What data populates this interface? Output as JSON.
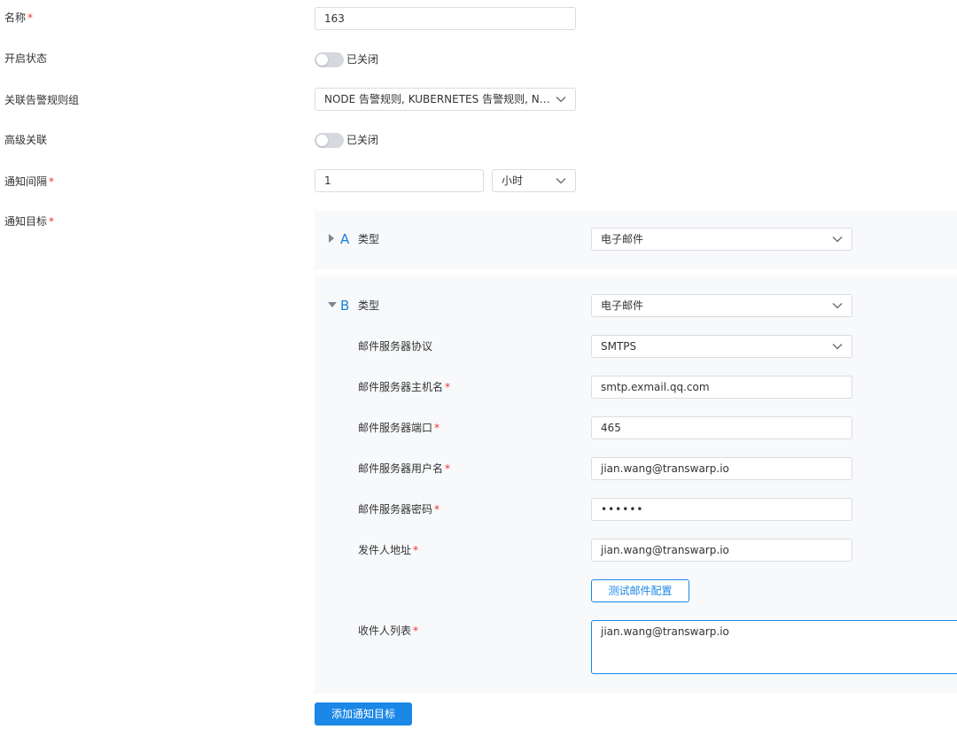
{
  "form": {
    "name": {
      "label": "名称",
      "value": "163"
    },
    "enabled": {
      "label": "开启状态",
      "state_text": "已关闭"
    },
    "rule_groups": {
      "label": "关联告警规则组",
      "value": "NODE 告警规则, KUBERNETES 告警规则, NETWORK 告警规则"
    },
    "advanced": {
      "label": "高级关联",
      "state_text": "已关闭"
    },
    "interval": {
      "label": "通知间隔",
      "value": "1",
      "unit": "小时"
    },
    "targets_label": "通知目标"
  },
  "targets": [
    {
      "letter": "A",
      "type_label": "类型",
      "type_value": "电子邮件",
      "expanded": false
    },
    {
      "letter": "B",
      "type_label": "类型",
      "type_value": "电子邮件",
      "expanded": true,
      "fields": {
        "protocol": {
          "label": "邮件服务器协议",
          "value": "SMTPS"
        },
        "host": {
          "label": "邮件服务器主机名",
          "value": "smtp.exmail.qq.com"
        },
        "port": {
          "label": "邮件服务器端口",
          "value": "465"
        },
        "username": {
          "label": "邮件服务器用户名",
          "value": "jian.wang@transwarp.io"
        },
        "password": {
          "label": "邮件服务器密码",
          "value": "••••••"
        },
        "sender": {
          "label": "发件人地址",
          "value": "jian.wang@transwarp.io"
        },
        "test_button": "测试邮件配置",
        "recipients": {
          "label": "收件人列表",
          "value": "jian.wang@transwarp.io"
        }
      }
    }
  ],
  "add_target_button": "添加通知目标",
  "icons": {
    "chevron": "chevron-down-icon",
    "collapsed": "caret-right-icon",
    "expanded": "caret-down-icon"
  },
  "colors": {
    "accent": "#1b87e6",
    "required": "#ee3333",
    "panel_bg": "#f7f9fb",
    "toggle_off": "#d5d8dd"
  }
}
